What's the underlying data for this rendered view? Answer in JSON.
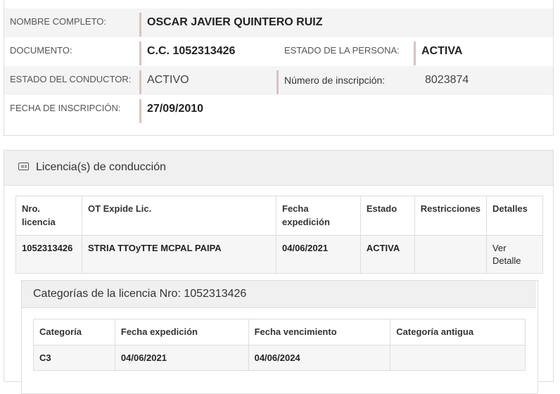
{
  "person": {
    "nombre_label": "NOMBRE COMPLETO:",
    "nombre_value": "OSCAR JAVIER QUINTERO RUIZ",
    "documento_label": "DOCUMENTO:",
    "documento_value": "C.C. 1052313426",
    "estado_persona_label": "ESTADO DE LA PERSONA:",
    "estado_persona_value": "ACTIVA",
    "estado_conductor_label": "ESTADO DEL CONDUCTOR:",
    "estado_conductor_value": "ACTIVO",
    "num_inscripcion_label": "Número de inscripción:",
    "num_inscripcion_value": "8023874",
    "fecha_inscripcion_label": "FECHA DE INSCRIPCIÓN:",
    "fecha_inscripcion_value": "27/09/2010"
  },
  "licencias": {
    "title": "Licencia(s) de conducción",
    "icon": "id-card-icon",
    "headers": [
      "Nro. licencia",
      "OT Expide Lic.",
      "Fecha expedición",
      "Estado",
      "Restricciones",
      "Detalles"
    ],
    "rows": [
      {
        "nro": "1052313426",
        "ot": "STRIA TTOyTTE MCPAL PAIPA",
        "fecha": "04/06/2021",
        "estado": "ACTIVA",
        "restricciones": "",
        "detalles": "Ver Detalle"
      }
    ]
  },
  "categorias": {
    "title": "Categorías de la licencia Nro: 1052313426",
    "headers": [
      "Categoría",
      "Fecha expedición",
      "Fecha vencimiento",
      "Categoría antigua"
    ],
    "rows": [
      {
        "categoria": "C3",
        "fecha_exp": "04/06/2021",
        "fecha_venc": "04/06/2024",
        "antigua": ""
      }
    ]
  }
}
